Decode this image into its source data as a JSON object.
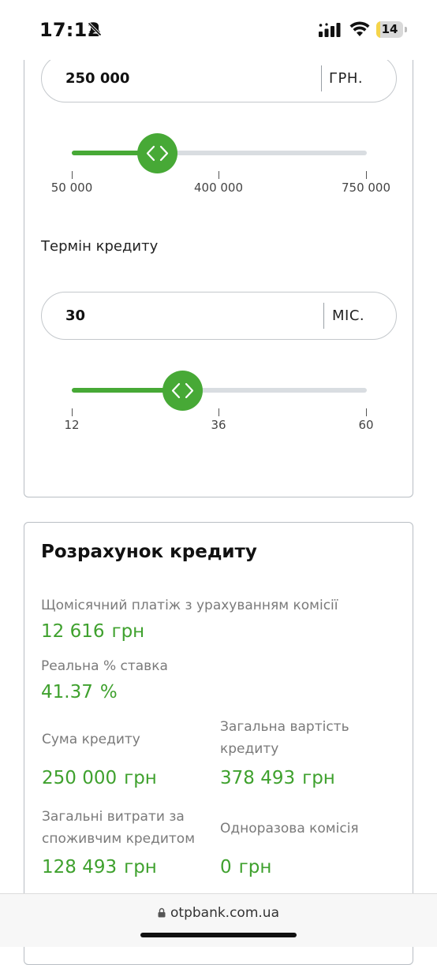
{
  "status_bar": {
    "time": "17:12",
    "battery_level": "14",
    "battery_fill_fraction": 0.14,
    "icons": [
      "bell-slash-icon",
      "cellular-signal-icon",
      "wifi-icon",
      "battery-icon"
    ]
  },
  "loan_amount": {
    "value": "250 000",
    "unit": "ГРН.",
    "slider": {
      "fill_fraction": 0.29,
      "ticks": [
        "50 000",
        "400 000",
        "750 000"
      ]
    }
  },
  "loan_term": {
    "label": "Термін кредиту",
    "value": "30",
    "unit": "МІС.",
    "slider": {
      "fill_fraction": 0.375,
      "ticks": [
        "12",
        "36",
        "60"
      ]
    }
  },
  "calculation": {
    "title": "Розрахунок кредиту",
    "monthly_payment": {
      "label": "Щомісячний платіж з урахуванням комісії",
      "value": "12 616",
      "unit": "грн"
    },
    "real_rate": {
      "label": "Реальна % ставка",
      "value": "41.37",
      "unit": "%"
    },
    "loan_sum": {
      "label": "Сума кредиту",
      "value": "250 000",
      "unit": "грн"
    },
    "total_cost": {
      "label": "Загальна вартість кредиту",
      "value": "378 493",
      "unit": "грн"
    },
    "total_expenses": {
      "label": "Загальні витрати за споживчим кредитом",
      "value": "128 493",
      "unit": "грн"
    },
    "one_time_fee": {
      "label": "Одноразова комісія",
      "value": "0",
      "unit": "грн"
    }
  },
  "browser": {
    "url": "otpbank.com.ua"
  },
  "colors": {
    "accent_green": "#47a936",
    "value_green": "#3fa12e",
    "track_gray": "#d9dde1",
    "battery_yellow": "#f5d44a"
  }
}
